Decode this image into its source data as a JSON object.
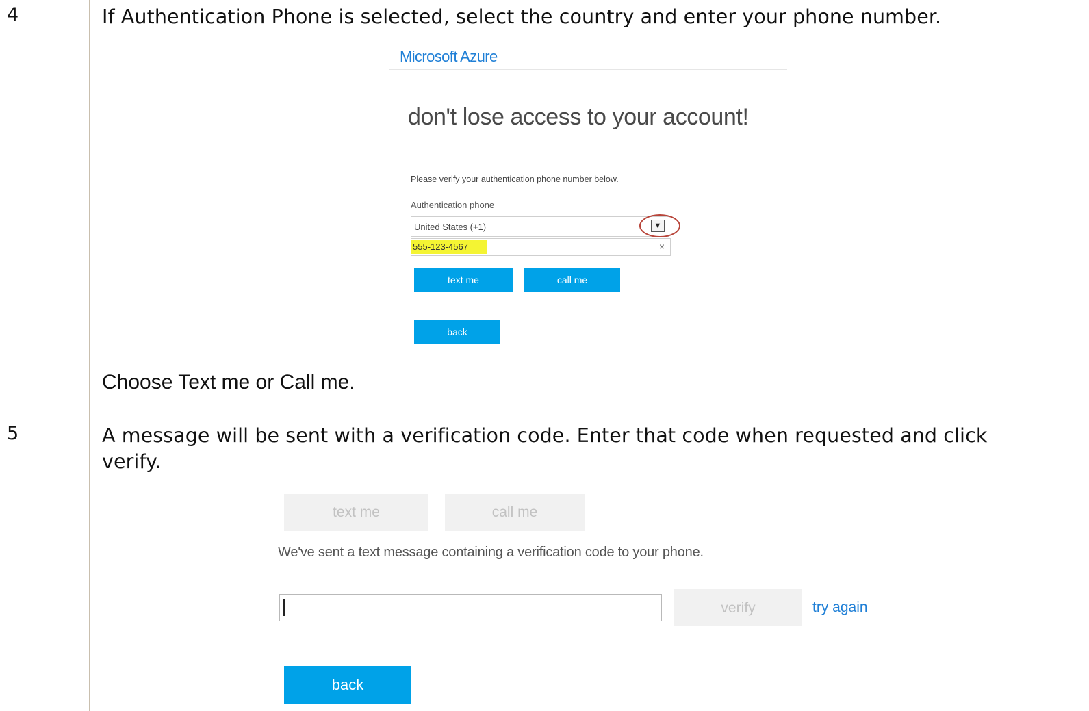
{
  "step4": {
    "number": "4",
    "text": "If Authentication Phone is selected, select the country and enter your phone number.",
    "note": "Choose Text me or Call me.",
    "screenshot": {
      "brand": "Microsoft Azure",
      "headline": "don't lose access to your account!",
      "instruction": "Please verify your authentication phone number below.",
      "field_label": "Authentication phone",
      "country_value": "United States (+1)",
      "phone_value": "555-123-4567",
      "clear_symbol": "×",
      "text_me": "text me",
      "call_me": "call me",
      "back": "back"
    }
  },
  "step5": {
    "number": "5",
    "text_line1": "A message will be sent with a verification code. Enter that code when requested and click",
    "text_line2": "verify.",
    "screenshot": {
      "text_me": "text me",
      "call_me": "call me",
      "message": "We've sent a text message containing a verification code to your phone.",
      "code_value": "",
      "verify": "verify",
      "try_again": "try again",
      "back": "back"
    }
  },
  "colors": {
    "accent_blue": "#00a2e8",
    "link_blue": "#1f7fd6",
    "highlight": "#f4f433",
    "annotation_circle": "#b8453a",
    "table_rule": "#c9bfae"
  }
}
